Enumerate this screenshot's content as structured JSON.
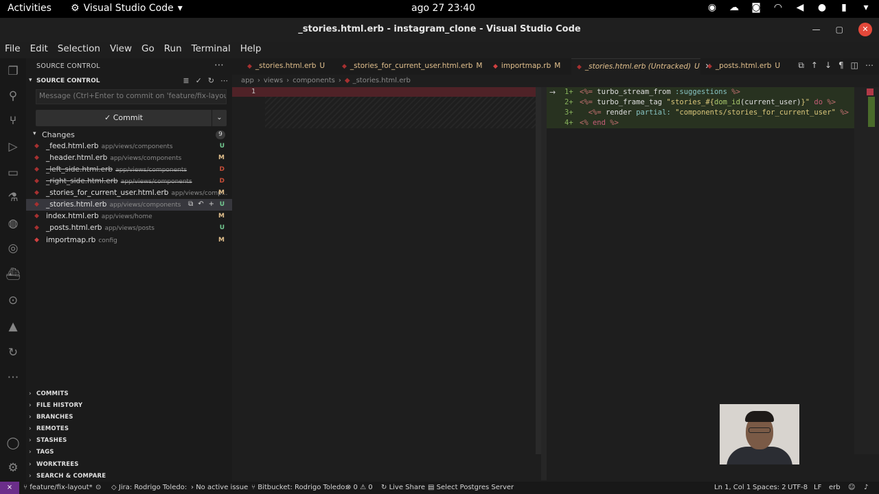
{
  "topbar": {
    "activities": "Activities",
    "app_name": "Visual Studio Code",
    "clock": "ago 27  23:40",
    "tray_icons": [
      "screen-record-icon",
      "weather-icon",
      "discord-icon",
      "wifi-icon",
      "volume-icon",
      "mic-icon",
      "battery-icon",
      "power-menu-icon"
    ]
  },
  "window": {
    "title": "_stories.html.erb - instagram_clone - Visual Studio Code"
  },
  "menu": [
    "File",
    "Edit",
    "Selection",
    "View",
    "Go",
    "Run",
    "Terminal",
    "Help"
  ],
  "sidebar": {
    "header": "SOURCE CONTROL",
    "section": "SOURCE CONTROL",
    "message_placeholder": "Message (Ctrl+Enter to commit on 'feature/fix-layout')",
    "commit_label": "✓ Commit",
    "changes_label": "Changes",
    "changes_count": "9",
    "files": [
      {
        "name": "_feed.html.erb",
        "path": "app/views/components",
        "status": "U"
      },
      {
        "name": "_header.html.erb",
        "path": "app/views/components",
        "status": "M"
      },
      {
        "name": "_left_side.html.erb",
        "path": "app/views/components",
        "status": "D"
      },
      {
        "name": "_right_side.html.erb",
        "path": "app/views/components",
        "status": "D"
      },
      {
        "name": "_stories_for_current_user.html.erb",
        "path": "app/views/comp...",
        "status": "M"
      },
      {
        "name": "_stories.html.erb",
        "path": "app/views/components",
        "status": "U"
      },
      {
        "name": "index.html.erb",
        "path": "app/views/home",
        "status": "M"
      },
      {
        "name": "_posts.html.erb",
        "path": "app/views/posts",
        "status": "U"
      },
      {
        "name": "importmap.rb",
        "path": "config",
        "status": "M"
      }
    ],
    "sections": [
      "COMMITS",
      "FILE HISTORY",
      "BRANCHES",
      "REMOTES",
      "STASHES",
      "TAGS",
      "WORKTREES",
      "SEARCH & COMPARE"
    ]
  },
  "tabs": [
    {
      "label": "_stories.html.erb",
      "status": "U"
    },
    {
      "label": "_stories_for_current_user.html.erb",
      "status": "M"
    },
    {
      "label": "importmap.rb",
      "status": "M"
    },
    {
      "label": "_stories.html.erb (Untracked)",
      "status": "U"
    },
    {
      "label": "_posts.html.erb",
      "status": "U"
    }
  ],
  "breadcrumb": [
    "app",
    "views",
    "components",
    "_stories.html.erb"
  ],
  "editor": {
    "left_line_number": "1",
    "right_lines": [
      {
        "num": "1+",
        "parts": [
          [
            "c-erb",
            "<%= "
          ],
          [
            "c-kw",
            "turbo_stream_from "
          ],
          [
            "c-sym",
            ":suggestions"
          ],
          [
            "c-erb",
            " %>"
          ]
        ]
      },
      {
        "num": "2+",
        "parts": [
          [
            "c-erb",
            "<%= "
          ],
          [
            "c-kw",
            "turbo_frame_tag "
          ],
          [
            "c-str",
            "\"stories_#{"
          ],
          [
            "c-fn",
            "dom_id"
          ],
          [
            "c-kw",
            "(current_user)"
          ],
          [
            "c-str",
            "}\""
          ],
          [
            "c-do",
            " do"
          ],
          [
            "c-erb",
            " %>"
          ]
        ]
      },
      {
        "num": "3+",
        "parts": [
          [
            "c-erb",
            "  <%= "
          ],
          [
            "c-kw",
            "render "
          ],
          [
            "c-sym",
            "partial: "
          ],
          [
            "c-str",
            "\"components/stories_for_current_user\""
          ],
          [
            "c-erb",
            " %>"
          ]
        ]
      },
      {
        "num": "4+",
        "parts": [
          [
            "c-erb",
            "<% "
          ],
          [
            "c-do",
            "end"
          ],
          [
            "c-erb",
            " %>"
          ]
        ]
      }
    ]
  },
  "statusbar": {
    "branch": "feature/fix-layout*",
    "jira": "Jira: Rodrigo Toledo:",
    "issue": "No active issue",
    "bitbucket": "Bitbucket: Rodrigo Toledo:",
    "problems": "⊗ 0 ⚠ 0",
    "liveshare": "Live Share",
    "postgres": "Select Postgres Server",
    "cursor": "Ln 1, Col 1",
    "spaces": "Spaces: 2",
    "encoding": "UTF-8",
    "eol": "LF",
    "language": "erb"
  }
}
